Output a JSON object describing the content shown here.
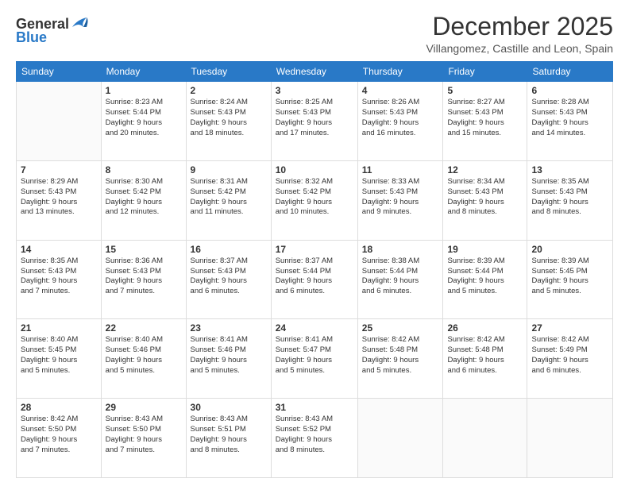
{
  "logo": {
    "general": "General",
    "blue": "Blue"
  },
  "title": "December 2025",
  "subtitle": "Villangomez, Castille and Leon, Spain",
  "days_header": [
    "Sunday",
    "Monday",
    "Tuesday",
    "Wednesday",
    "Thursday",
    "Friday",
    "Saturday"
  ],
  "weeks": [
    [
      {
        "day": "",
        "info": ""
      },
      {
        "day": "1",
        "info": "Sunrise: 8:23 AM\nSunset: 5:44 PM\nDaylight: 9 hours\nand 20 minutes."
      },
      {
        "day": "2",
        "info": "Sunrise: 8:24 AM\nSunset: 5:43 PM\nDaylight: 9 hours\nand 18 minutes."
      },
      {
        "day": "3",
        "info": "Sunrise: 8:25 AM\nSunset: 5:43 PM\nDaylight: 9 hours\nand 17 minutes."
      },
      {
        "day": "4",
        "info": "Sunrise: 8:26 AM\nSunset: 5:43 PM\nDaylight: 9 hours\nand 16 minutes."
      },
      {
        "day": "5",
        "info": "Sunrise: 8:27 AM\nSunset: 5:43 PM\nDaylight: 9 hours\nand 15 minutes."
      },
      {
        "day": "6",
        "info": "Sunrise: 8:28 AM\nSunset: 5:43 PM\nDaylight: 9 hours\nand 14 minutes."
      }
    ],
    [
      {
        "day": "7",
        "info": "Sunrise: 8:29 AM\nSunset: 5:43 PM\nDaylight: 9 hours\nand 13 minutes."
      },
      {
        "day": "8",
        "info": "Sunrise: 8:30 AM\nSunset: 5:42 PM\nDaylight: 9 hours\nand 12 minutes."
      },
      {
        "day": "9",
        "info": "Sunrise: 8:31 AM\nSunset: 5:42 PM\nDaylight: 9 hours\nand 11 minutes."
      },
      {
        "day": "10",
        "info": "Sunrise: 8:32 AM\nSunset: 5:42 PM\nDaylight: 9 hours\nand 10 minutes."
      },
      {
        "day": "11",
        "info": "Sunrise: 8:33 AM\nSunset: 5:43 PM\nDaylight: 9 hours\nand 9 minutes."
      },
      {
        "day": "12",
        "info": "Sunrise: 8:34 AM\nSunset: 5:43 PM\nDaylight: 9 hours\nand 8 minutes."
      },
      {
        "day": "13",
        "info": "Sunrise: 8:35 AM\nSunset: 5:43 PM\nDaylight: 9 hours\nand 8 minutes."
      }
    ],
    [
      {
        "day": "14",
        "info": "Sunrise: 8:35 AM\nSunset: 5:43 PM\nDaylight: 9 hours\nand 7 minutes."
      },
      {
        "day": "15",
        "info": "Sunrise: 8:36 AM\nSunset: 5:43 PM\nDaylight: 9 hours\nand 7 minutes."
      },
      {
        "day": "16",
        "info": "Sunrise: 8:37 AM\nSunset: 5:43 PM\nDaylight: 9 hours\nand 6 minutes."
      },
      {
        "day": "17",
        "info": "Sunrise: 8:37 AM\nSunset: 5:44 PM\nDaylight: 9 hours\nand 6 minutes."
      },
      {
        "day": "18",
        "info": "Sunrise: 8:38 AM\nSunset: 5:44 PM\nDaylight: 9 hours\nand 6 minutes."
      },
      {
        "day": "19",
        "info": "Sunrise: 8:39 AM\nSunset: 5:44 PM\nDaylight: 9 hours\nand 5 minutes."
      },
      {
        "day": "20",
        "info": "Sunrise: 8:39 AM\nSunset: 5:45 PM\nDaylight: 9 hours\nand 5 minutes."
      }
    ],
    [
      {
        "day": "21",
        "info": "Sunrise: 8:40 AM\nSunset: 5:45 PM\nDaylight: 9 hours\nand 5 minutes."
      },
      {
        "day": "22",
        "info": "Sunrise: 8:40 AM\nSunset: 5:46 PM\nDaylight: 9 hours\nand 5 minutes."
      },
      {
        "day": "23",
        "info": "Sunrise: 8:41 AM\nSunset: 5:46 PM\nDaylight: 9 hours\nand 5 minutes."
      },
      {
        "day": "24",
        "info": "Sunrise: 8:41 AM\nSunset: 5:47 PM\nDaylight: 9 hours\nand 5 minutes."
      },
      {
        "day": "25",
        "info": "Sunrise: 8:42 AM\nSunset: 5:48 PM\nDaylight: 9 hours\nand 5 minutes."
      },
      {
        "day": "26",
        "info": "Sunrise: 8:42 AM\nSunset: 5:48 PM\nDaylight: 9 hours\nand 6 minutes."
      },
      {
        "day": "27",
        "info": "Sunrise: 8:42 AM\nSunset: 5:49 PM\nDaylight: 9 hours\nand 6 minutes."
      }
    ],
    [
      {
        "day": "28",
        "info": "Sunrise: 8:42 AM\nSunset: 5:50 PM\nDaylight: 9 hours\nand 7 minutes."
      },
      {
        "day": "29",
        "info": "Sunrise: 8:43 AM\nSunset: 5:50 PM\nDaylight: 9 hours\nand 7 minutes."
      },
      {
        "day": "30",
        "info": "Sunrise: 8:43 AM\nSunset: 5:51 PM\nDaylight: 9 hours\nand 8 minutes."
      },
      {
        "day": "31",
        "info": "Sunrise: 8:43 AM\nSunset: 5:52 PM\nDaylight: 9 hours\nand 8 minutes."
      },
      {
        "day": "",
        "info": ""
      },
      {
        "day": "",
        "info": ""
      },
      {
        "day": "",
        "info": ""
      }
    ]
  ]
}
